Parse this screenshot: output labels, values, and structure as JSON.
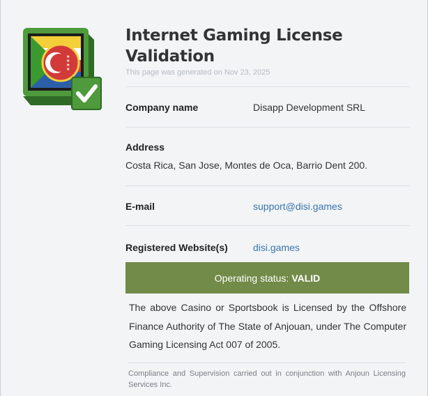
{
  "page": {
    "title": "Internet Gaming License Validation",
    "generated": "This page was generated on Nov 23, 2025"
  },
  "details": {
    "company_label": "Company name",
    "company_value": "Disapp Development SRL",
    "address_label": "Address",
    "address_value": "Costa Rica, San Jose, Montes de Oca, Barrio Dent 200.",
    "email_label": "E-mail",
    "email_value": "support@disi.games",
    "website_label": "Registered Website(s)",
    "website_value": "disi.games"
  },
  "status": {
    "prefix": "Operating status:",
    "value": "VALID"
  },
  "license_text": "The above Casino or Sportsbook is Licensed by the Offshore Finance Authority of The State of Anjouan, under The Computer Gaming Licensing Act 007 of 2005.",
  "footnote": "Compliance and Supervision carried out in conjunction with Anjoun Licensing Services Inc.",
  "colors": {
    "status_bg": "#728b49",
    "link": "#3a75ad",
    "badge_green": "#4f9a3c"
  },
  "icons": {
    "logo": "license-seal-icon",
    "check": "checkmark-icon"
  }
}
